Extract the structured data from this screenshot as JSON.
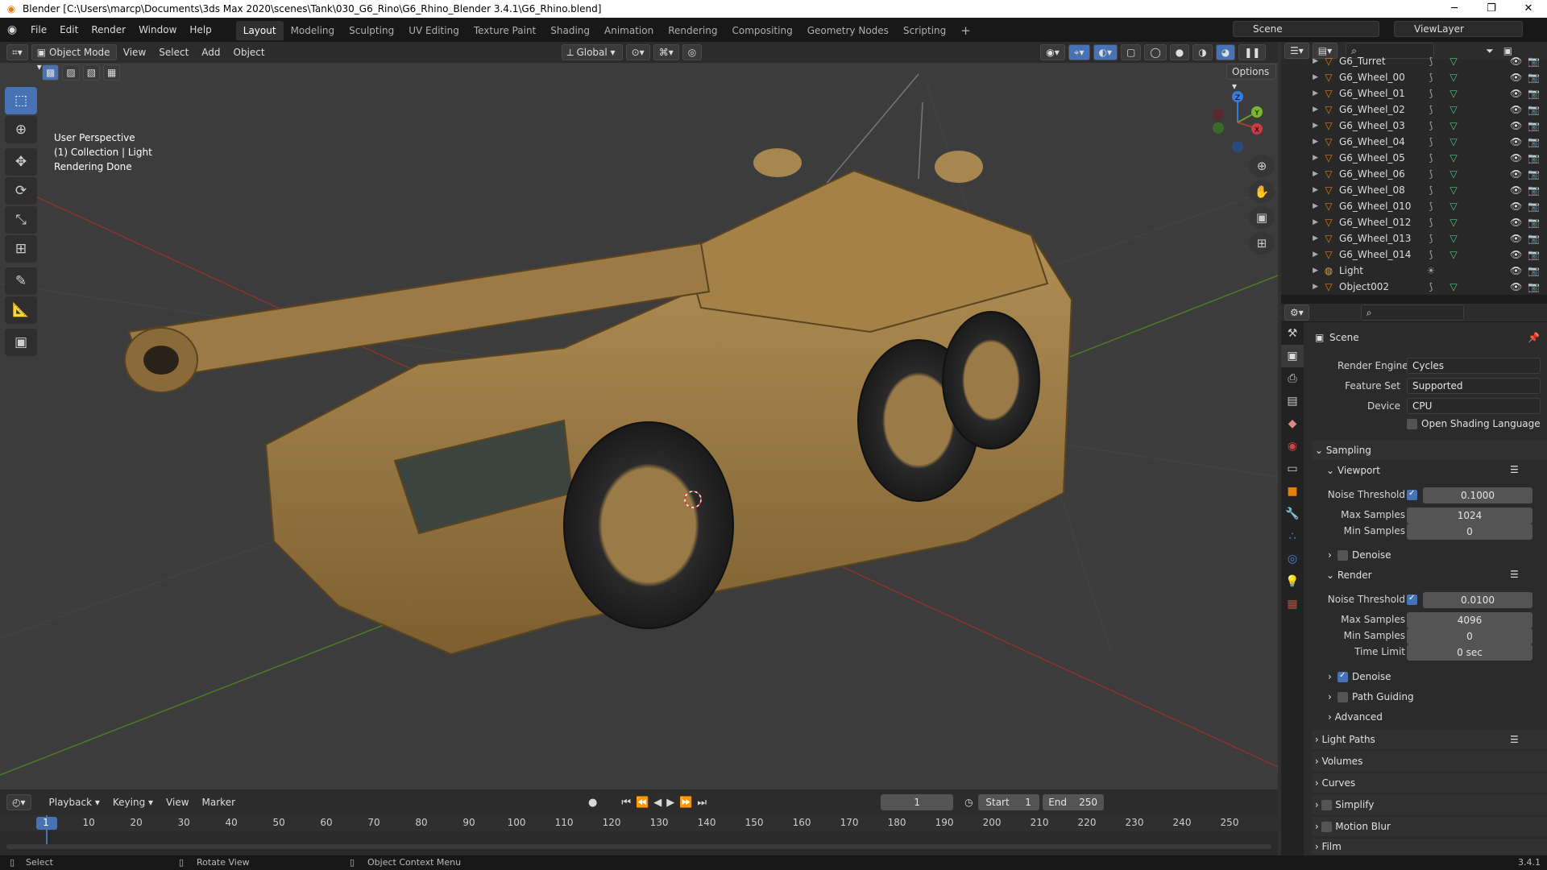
{
  "window": {
    "title": "Blender [C:\\Users\\marcp\\Documents\\3ds Max 2020\\scenes\\Tank\\030_G6_Rino\\G6_Rhino_Blender 3.4.1\\G6_Rhino.blend]"
  },
  "menu": [
    "File",
    "Edit",
    "Render",
    "Window",
    "Help"
  ],
  "workspaces": [
    "Layout",
    "Modeling",
    "Sculpting",
    "UV Editing",
    "Texture Paint",
    "Shading",
    "Animation",
    "Rendering",
    "Compositing",
    "Geometry Nodes",
    "Scripting"
  ],
  "top_right": {
    "scene": "Scene",
    "viewlayer": "ViewLayer"
  },
  "viewport_header": {
    "mode": "Object Mode",
    "menus": [
      "View",
      "Select",
      "Add",
      "Object"
    ],
    "orientation": "Global",
    "options": "Options"
  },
  "viewport_info": {
    "line1": "User Perspective",
    "line2": "(1) Collection | Light",
    "line3": "Rendering Done"
  },
  "gizmo": {
    "x": "X",
    "y": "Y",
    "z": "Z"
  },
  "outliner": {
    "partial": "G6_Turret",
    "items": [
      "G6_Wheel_00",
      "G6_Wheel_01",
      "G6_Wheel_02",
      "G6_Wheel_03",
      "G6_Wheel_04",
      "G6_Wheel_05",
      "G6_Wheel_06",
      "G6_Wheel_08",
      "G6_Wheel_010",
      "G6_Wheel_012",
      "G6_Wheel_013",
      "G6_Wheel_014",
      "Light",
      "Object002"
    ]
  },
  "properties": {
    "context": "Scene",
    "render_engine_label": "Render Engine",
    "render_engine": "Cycles",
    "feature_set_label": "Feature Set",
    "feature_set": "Supported",
    "device_label": "Device",
    "device": "CPU",
    "osl": "Open Shading Language",
    "sampling": "Sampling",
    "viewport": "Viewport",
    "noise_threshold_label": "Noise Threshold",
    "viewport_noise": "0.1000",
    "max_samples_label": "Max Samples",
    "viewport_max": "1024",
    "min_samples_label": "Min Samples",
    "viewport_min": "0",
    "denoise": "Denoise",
    "render": "Render",
    "render_noise": "0.0100",
    "render_max": "4096",
    "render_min": "0",
    "time_limit_label": "Time Limit",
    "time_limit": "0 sec",
    "path_guiding": "Path Guiding",
    "advanced": "Advanced",
    "panels": [
      "Light Paths",
      "Volumes",
      "Curves",
      "Simplify",
      "Motion Blur",
      "Film"
    ]
  },
  "timeline_header": {
    "menus": [
      "Playback",
      "Keying",
      "View",
      "Marker"
    ],
    "current": "1",
    "start_label": "Start",
    "start": "1",
    "end_label": "End",
    "end": "250"
  },
  "timeline": {
    "ticks": [
      "1",
      "10",
      "20",
      "30",
      "40",
      "50",
      "60",
      "70",
      "80",
      "90",
      "100",
      "110",
      "120",
      "130",
      "140",
      "150",
      "160",
      "170",
      "180",
      "190",
      "200",
      "210",
      "220",
      "230",
      "240",
      "250"
    ]
  },
  "status": {
    "select": "Select",
    "rotate": "Rotate View",
    "context": "Object Context Menu",
    "version": "3.4.1"
  },
  "colors": {
    "accent": "#4772b3",
    "vehicle": "#a0804a",
    "x_axis": "#a63a3a",
    "y_axis": "#6a9a2a",
    "z_axis": "#3a7adb"
  }
}
